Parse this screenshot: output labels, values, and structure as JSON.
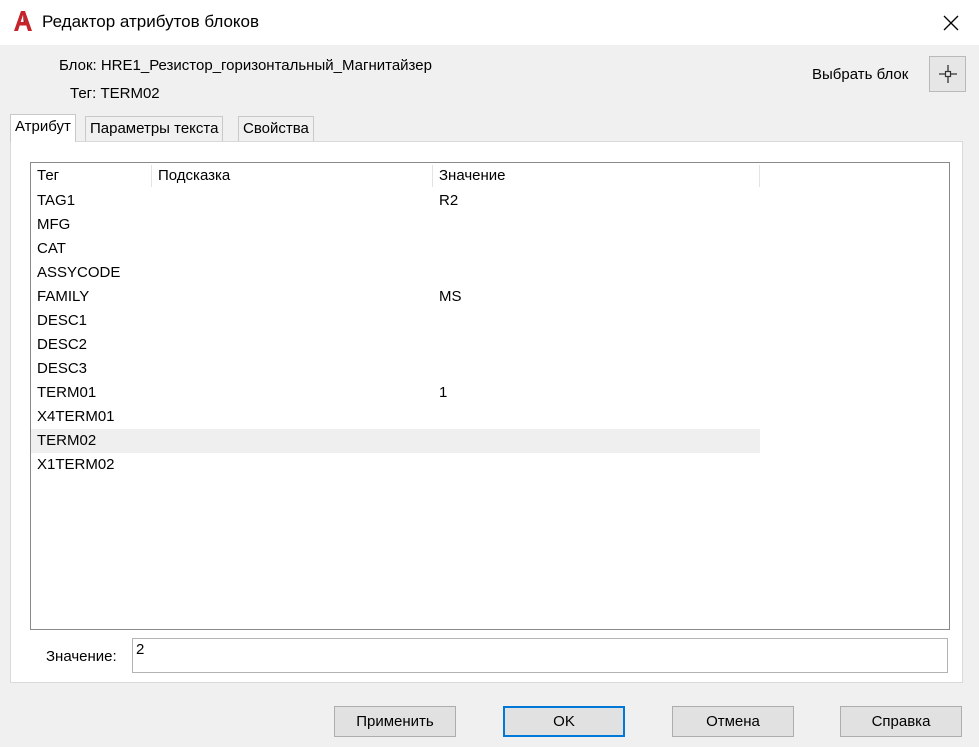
{
  "window": {
    "title": "Редактор атрибутов блоков",
    "app_icon": "autocad-logo-icon",
    "close_icon": "close-icon"
  },
  "block_info": {
    "block_line": "Блок: HRE1_Резистор_горизонтальный_Магнитайзер",
    "tag_line": "Тег: TERM02",
    "pick_label": "Выбрать блок",
    "pick_icon": "crosshair-icon"
  },
  "tabs": [
    {
      "label": "Атрибут",
      "active": true
    },
    {
      "label": "Параметры текста",
      "active": false
    },
    {
      "label": "Свойства",
      "active": false
    }
  ],
  "attribute_list": {
    "columns": [
      "Тег",
      "Подсказка",
      "Значение"
    ],
    "rows": [
      {
        "tag": "TAG1",
        "prompt": "",
        "value": "R2"
      },
      {
        "tag": "MFG",
        "prompt": "",
        "value": ""
      },
      {
        "tag": "CAT",
        "prompt": "",
        "value": ""
      },
      {
        "tag": "ASSYCODE",
        "prompt": "",
        "value": ""
      },
      {
        "tag": "FAMILY",
        "prompt": "",
        "value": "MS"
      },
      {
        "tag": "DESC1",
        "prompt": "",
        "value": ""
      },
      {
        "tag": "DESC2",
        "prompt": "",
        "value": ""
      },
      {
        "tag": "DESC3",
        "prompt": "",
        "value": ""
      },
      {
        "tag": "TERM01",
        "prompt": "",
        "value": "1"
      },
      {
        "tag": "X4TERM01",
        "prompt": "",
        "value": ""
      },
      {
        "tag": "TERM02",
        "prompt": "",
        "value": ""
      },
      {
        "tag": "X1TERM02",
        "prompt": "",
        "value": ""
      }
    ],
    "selected_index": 10
  },
  "value_field": {
    "label": "Значение:",
    "value": "2"
  },
  "buttons": {
    "apply": "Применить",
    "ok": "OK",
    "cancel": "Отмена",
    "help": "Справка"
  },
  "colors": {
    "app_icon_red": "#c5242b",
    "default_button_border": "#0078d7",
    "selected_row": "#efefef"
  }
}
